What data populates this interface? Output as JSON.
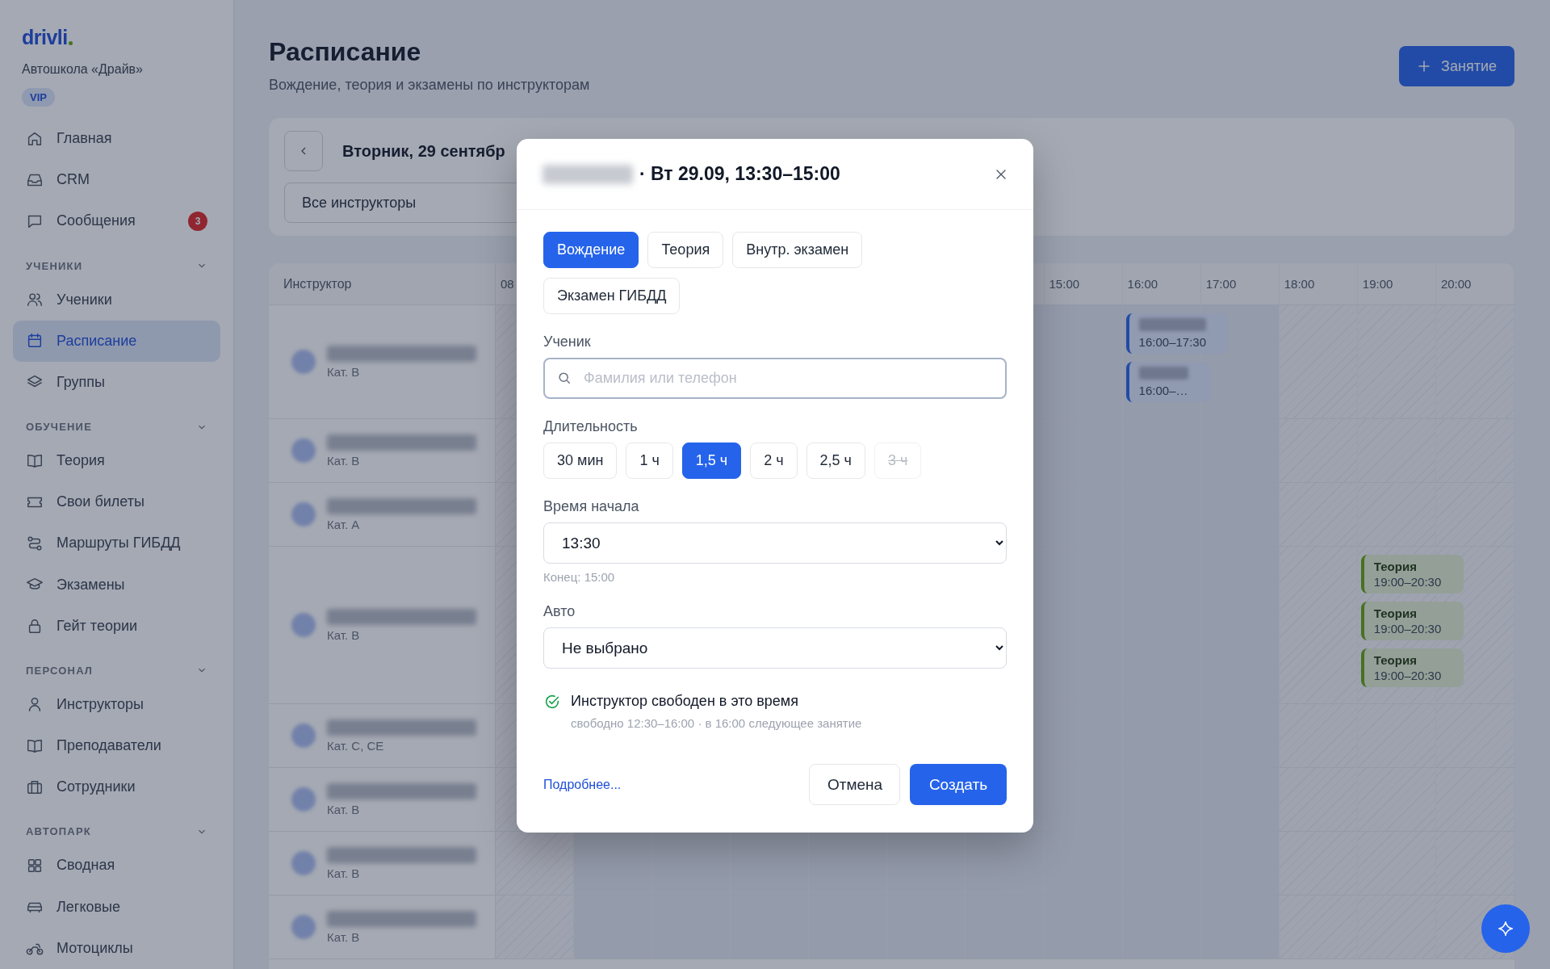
{
  "sidebar": {
    "logo": "drivli",
    "school": "Автошкола «Драйв»",
    "badge": "VIP",
    "sections": [
      {
        "items": [
          {
            "label": "Главная",
            "selected": false
          },
          {
            "label": "CRM",
            "selected": false
          },
          {
            "label": "Сообщения",
            "selected": false,
            "count": "3"
          }
        ]
      },
      {
        "title": "УЧЕНИКИ",
        "expanded": true,
        "items": [
          {
            "label": "Ученики",
            "selected": false
          },
          {
            "label": "Расписание",
            "selected": true
          },
          {
            "label": "Группы",
            "selected": false
          }
        ]
      },
      {
        "title": "ОБУЧЕНИЕ",
        "expanded": true,
        "items": [
          {
            "label": "Теория",
            "selected": false
          },
          {
            "label": "Свои билеты",
            "selected": false
          },
          {
            "label": "Маршруты ГИБДД",
            "selected": false
          },
          {
            "label": "Экзамены",
            "selected": false
          },
          {
            "label": "Гейт теории",
            "selected": false
          }
        ]
      },
      {
        "title": "ПЕРСОНАЛ",
        "expanded": true,
        "items": [
          {
            "label": "Инструкторы",
            "selected": false
          },
          {
            "label": "Преподаватели",
            "selected": false
          },
          {
            "label": "Сотрудники",
            "selected": false
          }
        ]
      },
      {
        "title": "АВТОПАРК",
        "expanded": true,
        "items": [
          {
            "label": "Сводная",
            "selected": false
          },
          {
            "label": "Легковые",
            "selected": false
          },
          {
            "label": "Мотоциклы",
            "selected": false
          }
        ]
      }
    ]
  },
  "header": {
    "title": "Расписание",
    "subtitle": "Вождение, теория и экзамены по инструкторам",
    "add_button": "Занятие"
  },
  "toolbar": {
    "date": "Вторник, 29 сентябр",
    "instructor_filter": "Все инструкторы"
  },
  "schedule": {
    "columns": [
      "Инструктор",
      "08",
      "15:00",
      "16:00",
      "17:00",
      "18:00",
      "19:00",
      "20:00"
    ],
    "rows": [
      {
        "category": "Кат. B",
        "events": [
          {
            "kind": "driving",
            "time": "16:00–17:30"
          },
          {
            "kind": "driving",
            "time": "16:00–…"
          }
        ]
      },
      {
        "category": "Кат. B"
      },
      {
        "category": "Кат. A"
      },
      {
        "category": "Кат. B",
        "events": [
          {
            "kind": "theory",
            "title": "Теория",
            "time": "19:00–20:30"
          },
          {
            "kind": "theory",
            "title": "Теория",
            "time": "19:00–20:30"
          },
          {
            "kind": "theory",
            "title": "Теория",
            "time": "19:00–20:30"
          }
        ]
      },
      {
        "category": "Кат. C, CE"
      },
      {
        "category": "Кат. B"
      },
      {
        "category": "Кат. B"
      },
      {
        "category": "Кат. B"
      }
    ]
  },
  "modal": {
    "title": "· Вт 29.09, 13:30–15:00",
    "types": [
      {
        "label": "Вождение",
        "selected": true
      },
      {
        "label": "Теория",
        "selected": false
      },
      {
        "label": "Внутр. экзамен",
        "selected": false
      },
      {
        "label": "Экзамен ГИБДД",
        "selected": false
      }
    ],
    "student": {
      "label": "Ученик",
      "placeholder": "Фамилия или телефон"
    },
    "duration": {
      "label": "Длительность",
      "options": [
        {
          "label": "30 мин",
          "selected": false,
          "disabled": false
        },
        {
          "label": "1 ч",
          "selected": false,
          "disabled": false
        },
        {
          "label": "1,5 ч",
          "selected": true,
          "disabled": false
        },
        {
          "label": "2 ч",
          "selected": false,
          "disabled": false
        },
        {
          "label": "2,5 ч",
          "selected": false,
          "disabled": false
        },
        {
          "label": "3 ч",
          "selected": false,
          "disabled": true
        }
      ]
    },
    "start": {
      "label": "Время начала",
      "value": "13:30",
      "hint": "Конец: 15:00"
    },
    "car": {
      "label": "Авто",
      "value": "Не выбрано"
    },
    "status": {
      "title": "Инструктор свободен в это время",
      "detail": "свободно 12:30–16:00 · в 16:00 следующее занятие"
    },
    "link": "Подробнее...",
    "cancel": "Отмена",
    "submit": "Создать"
  }
}
